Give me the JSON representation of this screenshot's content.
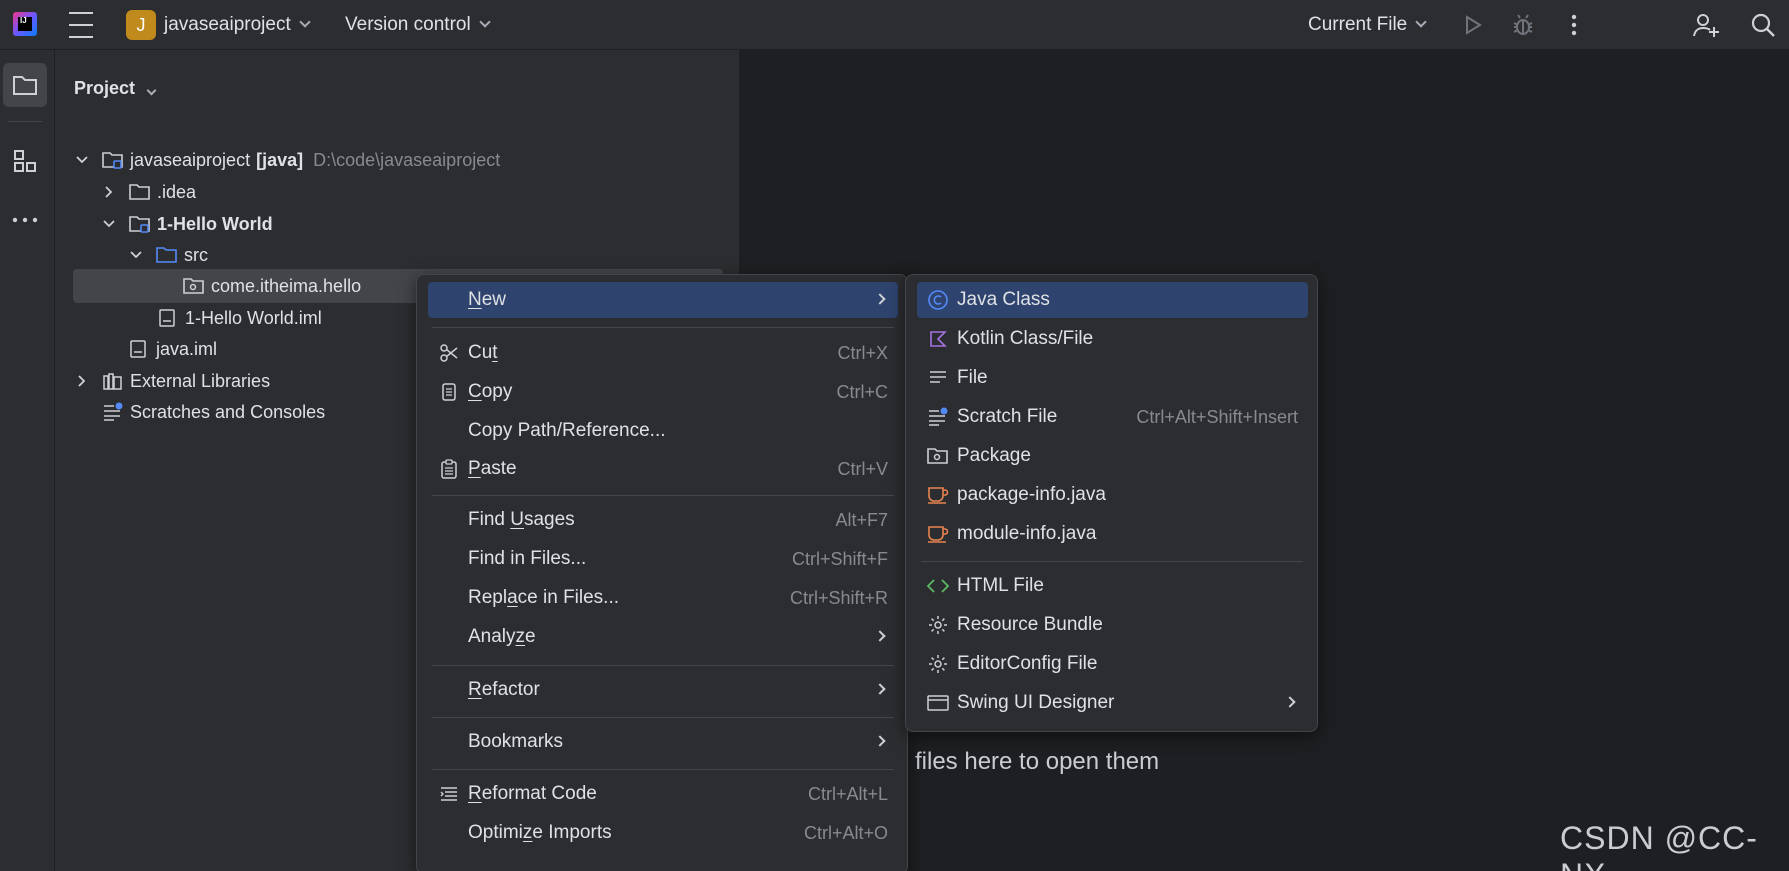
{
  "titlebar": {
    "project_badge": "J",
    "project_name": "javaseaiproject",
    "version_control": "Version control",
    "run_config": "Current File"
  },
  "project_panel": {
    "title": "Project",
    "tree": [
      {
        "label": "javaseaiproject",
        "bold_suffix": "[java]",
        "path": "D:\\code\\javaseaiproject"
      },
      {
        "label": ".idea"
      },
      {
        "label": "1-Hello World"
      },
      {
        "label": "src"
      },
      {
        "label": "come.itheima.hello"
      },
      {
        "label": "1-Hello World.iml"
      },
      {
        "label": "java.iml"
      },
      {
        "label": "External Libraries"
      },
      {
        "label": "Scratches and Consoles"
      }
    ]
  },
  "context_menu": {
    "items": [
      {
        "pre": "",
        "u": "N",
        "post": "ew",
        "shortcut": ""
      },
      {
        "pre": "Cu",
        "u": "t",
        "post": "",
        "shortcut": "Ctrl+X"
      },
      {
        "pre": "",
        "u": "C",
        "post": "opy",
        "shortcut": "Ctrl+C"
      },
      {
        "pre": "Copy Path/Reference...",
        "u": "",
        "post": "",
        "shortcut": ""
      },
      {
        "pre": "",
        "u": "P",
        "post": "aste",
        "shortcut": "Ctrl+V"
      },
      {
        "pre": "Find ",
        "u": "U",
        "post": "sages",
        "shortcut": "Alt+F7"
      },
      {
        "pre": "Find in Files...",
        "u": "",
        "post": "",
        "shortcut": "Ctrl+Shift+F"
      },
      {
        "pre": "Repl",
        "u": "a",
        "post": "ce in Files...",
        "shortcut": "Ctrl+Shift+R"
      },
      {
        "pre": "Analy",
        "u": "z",
        "post": "e",
        "shortcut": ""
      },
      {
        "pre": "",
        "u": "R",
        "post": "efactor",
        "shortcut": ""
      },
      {
        "pre": "Bookmarks",
        "u": "",
        "post": "",
        "shortcut": ""
      },
      {
        "pre": "",
        "u": "R",
        "post": "eformat Code",
        "shortcut": "Ctrl+Alt+L"
      },
      {
        "pre": "Optimi",
        "u": "z",
        "post": "e Imports",
        "shortcut": "Ctrl+Alt+O"
      }
    ]
  },
  "submenu": {
    "items": [
      {
        "label": "Java Class",
        "shortcut": ""
      },
      {
        "label": "Kotlin Class/File",
        "shortcut": ""
      },
      {
        "label": "File",
        "shortcut": ""
      },
      {
        "label": "Scratch File",
        "shortcut": "Ctrl+Alt+Shift+Insert"
      },
      {
        "label": "Package",
        "shortcut": ""
      },
      {
        "label": "package-info.java",
        "shortcut": ""
      },
      {
        "label": "module-info.java",
        "shortcut": ""
      },
      {
        "label": "HTML File",
        "shortcut": ""
      },
      {
        "label": "Resource Bundle",
        "shortcut": ""
      },
      {
        "label": "EditorConfig File",
        "shortcut": ""
      },
      {
        "label": "Swing UI Designer",
        "shortcut": ""
      }
    ]
  },
  "editor": {
    "empty_hint": "files here to open them",
    "watermark": "CSDN @CC-NX"
  }
}
